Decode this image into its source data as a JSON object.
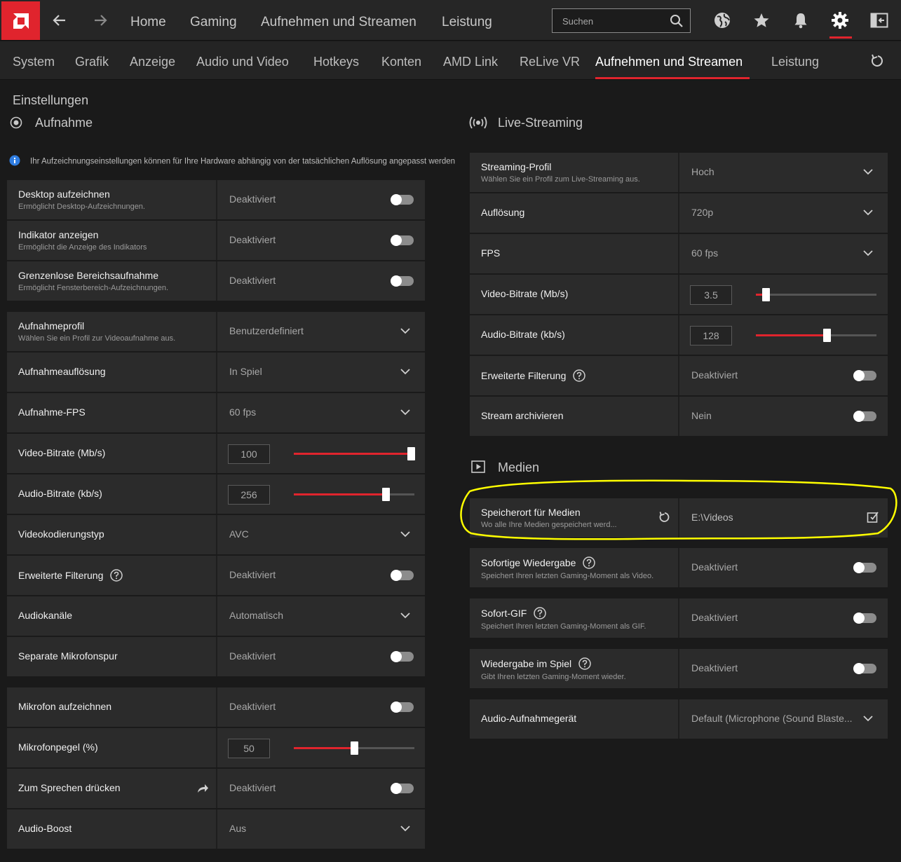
{
  "topbar": {
    "nav": [
      "Home",
      "Gaming",
      "Aufnehmen und Streamen",
      "Leistung"
    ],
    "search_placeholder": "Suchen"
  },
  "subnav": {
    "tabs": [
      "System",
      "Grafik",
      "Anzeige",
      "Audio und Video",
      "Hotkeys",
      "Konten",
      "AMD Link",
      "ReLive VR",
      "Aufnehmen und Streamen",
      "Leistung"
    ],
    "active": "Aufnehmen und Streamen"
  },
  "page_title": "Einstellungen",
  "recording": {
    "heading": "Aufnahme",
    "info": "Ihr Aufzeichnungseinstellungen können für Ihre Hardware abhängig von der tatsächlichen Auflösung angepasst werden",
    "desktop": {
      "label": "Desktop aufzeichnen",
      "sub": "Ermöglicht Desktop-Aufzeichnungen.",
      "value": "Deaktiviert"
    },
    "indicator": {
      "label": "Indikator anzeigen",
      "sub": "Ermöglicht die Anzeige des Indikators",
      "value": "Deaktiviert"
    },
    "borderless": {
      "label": "Grenzenlose Bereichsaufnahme",
      "sub": "Ermöglicht Fensterbereich-Aufzeichnungen.",
      "value": "Deaktiviert"
    },
    "profile": {
      "label": "Aufnahmeprofil",
      "sub": "Wählen Sie ein Profil zur Videoaufnahme aus.",
      "value": "Benutzerdefiniert"
    },
    "resolution": {
      "label": "Aufnahmeauflösung",
      "value": "In Spiel"
    },
    "fps": {
      "label": "Aufnahme-FPS",
      "value": "60 fps"
    },
    "video_bitrate": {
      "label": "Video-Bitrate (Mb/s)",
      "value": "100",
      "level": 0.97
    },
    "audio_bitrate": {
      "label": "Audio-Bitrate (kb/s)",
      "value": "256",
      "level": 0.76
    },
    "encoding": {
      "label": "Videokodierungstyp",
      "value": "AVC"
    },
    "filtering": {
      "label": "Erweiterte Filterung",
      "value": "Deaktiviert"
    },
    "audio_channels": {
      "label": "Audiokanäle",
      "value": "Automatisch"
    },
    "mic_track": {
      "label": "Separate Mikrofonspur",
      "value": "Deaktiviert"
    },
    "record_mic": {
      "label": "Mikrofon aufzeichnen",
      "value": "Deaktiviert"
    },
    "mic_level": {
      "label": "Mikrofonpegel (%)",
      "value": "50",
      "level": 0.5
    },
    "push_to_talk": {
      "label": "Zum Sprechen drücken",
      "value": "Deaktiviert"
    },
    "audio_boost": {
      "label": "Audio-Boost",
      "value": "Aus"
    }
  },
  "streaming": {
    "heading": "Live-Streaming",
    "profile": {
      "label": "Streaming-Profil",
      "sub": "Wählen Sie ein Profil zum Live-Streaming aus.",
      "value": "Hoch"
    },
    "resolution": {
      "label": "Auflösung",
      "value": "720p"
    },
    "fps": {
      "label": "FPS",
      "value": "60 fps"
    },
    "video_bitrate": {
      "label": "Video-Bitrate (Mb/s)",
      "value": "3.5",
      "level": 0.08
    },
    "audio_bitrate": {
      "label": "Audio-Bitrate (kb/s)",
      "value": "128",
      "level": 0.59
    },
    "filtering": {
      "label": "Erweiterte Filterung",
      "value": "Deaktiviert"
    },
    "archive": {
      "label": "Stream archivieren",
      "value": "Nein"
    }
  },
  "media": {
    "heading": "Medien",
    "location": {
      "label": "Speicherort für Medien",
      "sub": "Wo alle Ihre Medien gespeichert werd...",
      "value": "E:\\Videos"
    },
    "instant_replay": {
      "label": "Sofortige Wiedergabe",
      "sub": "Speichert Ihren letzten Gaming-Moment als Video.",
      "value": "Deaktiviert"
    },
    "instant_gif": {
      "label": "Sofort-GIF",
      "sub": "Speichert Ihren letzten Gaming-Moment als GIF.",
      "value": "Deaktiviert"
    },
    "in_game_replay": {
      "label": "Wiedergabe im Spiel",
      "sub": "Gibt Ihren letzten Gaming-Moment wieder.",
      "value": "Deaktiviert"
    },
    "audio_device": {
      "label": "Audio-Aufnahmegerät",
      "value": "Default (Microphone (Sound Blaste..."
    }
  },
  "colors": {
    "accent": "#e0242d",
    "highlight": "#ffff00"
  }
}
